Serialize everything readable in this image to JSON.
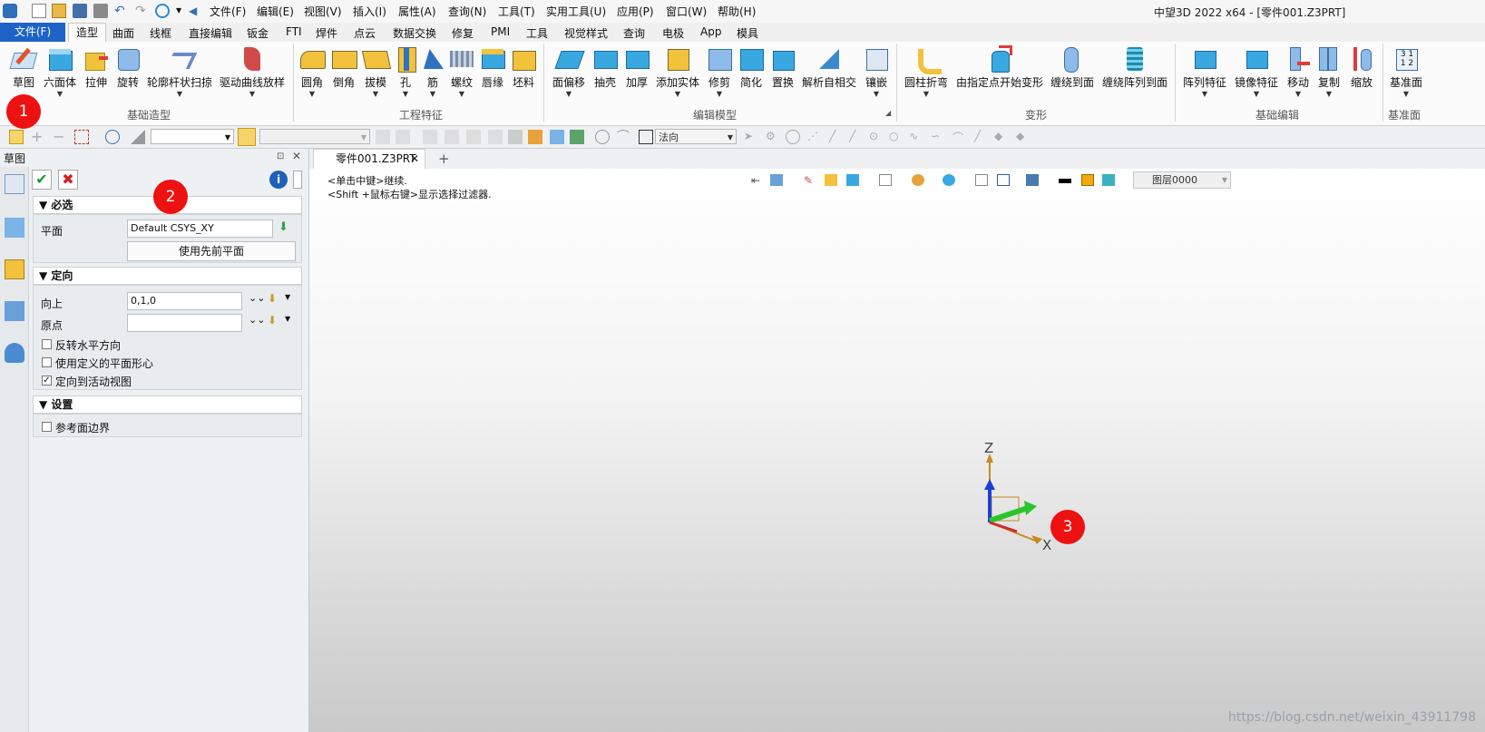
{
  "title_bar": {
    "doc_title": "中望3D 2022 x64 - [零件001.Z3PRT]",
    "menus": [
      "文件(F)",
      "编辑(E)",
      "视图(V)",
      "插入(I)",
      "属性(A)",
      "查询(N)",
      "工具(T)",
      "实用工具(U)",
      "应用(P)",
      "窗口(W)",
      "帮助(H)"
    ]
  },
  "ribbon_tabs": {
    "file": "文件(F)",
    "active": "造型",
    "tabs": [
      "曲面",
      "线框",
      "直接编辑",
      "钣金",
      "FTI",
      "焊件",
      "点云",
      "数据交换",
      "修复",
      "PMI",
      "工具",
      "视觉样式",
      "查询",
      "电极",
      "App",
      "模具"
    ]
  },
  "ribbon": {
    "buttons": [
      "草图",
      "六面体",
      "拉伸",
      "旋转",
      "轮廓杆状扫掠",
      "驱动曲线放样",
      "圆角",
      "倒角",
      "拔模",
      "孔",
      "筋",
      "螺纹",
      "唇缘",
      "坯料",
      "面偏移",
      "抽壳",
      "加厚",
      "添加实体",
      "修剪",
      "简化",
      "置换",
      "解析自相交",
      "镶嵌",
      "圆柱折弯",
      "由指定点开始变形",
      "缠绕到面",
      "缠绕阵列到面",
      "阵列特征",
      "镜像特征",
      "移动",
      "复制",
      "缩放",
      "基准面"
    ],
    "groups": [
      "基础造型",
      "工程特征",
      "编辑模型",
      "变形",
      "基础编辑",
      "基准面"
    ]
  },
  "toolbar": {
    "normal_combo": "法向"
  },
  "panel": {
    "title": "草图",
    "required": {
      "header": "必选",
      "plane_label": "平面",
      "plane_value": "Default CSYS_XY",
      "use_prev_plane": "使用先前平面"
    },
    "orientation": {
      "header": "定向",
      "up_label": "向上",
      "up_value": "0,1,0",
      "origin_label": "原点",
      "origin_value": "",
      "reverse_h": "反转水平方向",
      "use_plane_center": "使用定义的平面形心",
      "orient_active": "定向到活动视图"
    },
    "settings": {
      "header": "设置",
      "ref_boundary": "参考面边界"
    }
  },
  "viewport": {
    "doc_tab": "零件001.Z3PRT",
    "hint1": "<单击中键>继续.",
    "hint2": "<Shift +鼠标右键>显示选择过滤器.",
    "layer": "图层0000",
    "axis_x": "X",
    "axis_z": "Z"
  },
  "callouts": [
    "1",
    "2",
    "3"
  ],
  "watermark": "https://blog.csdn.net/weixin_43911798",
  "colors": {
    "file_tab": "#1d63c7",
    "callout": "#e11111",
    "ok_green": "#1a9e2a",
    "cancel_red": "#d62020"
  }
}
